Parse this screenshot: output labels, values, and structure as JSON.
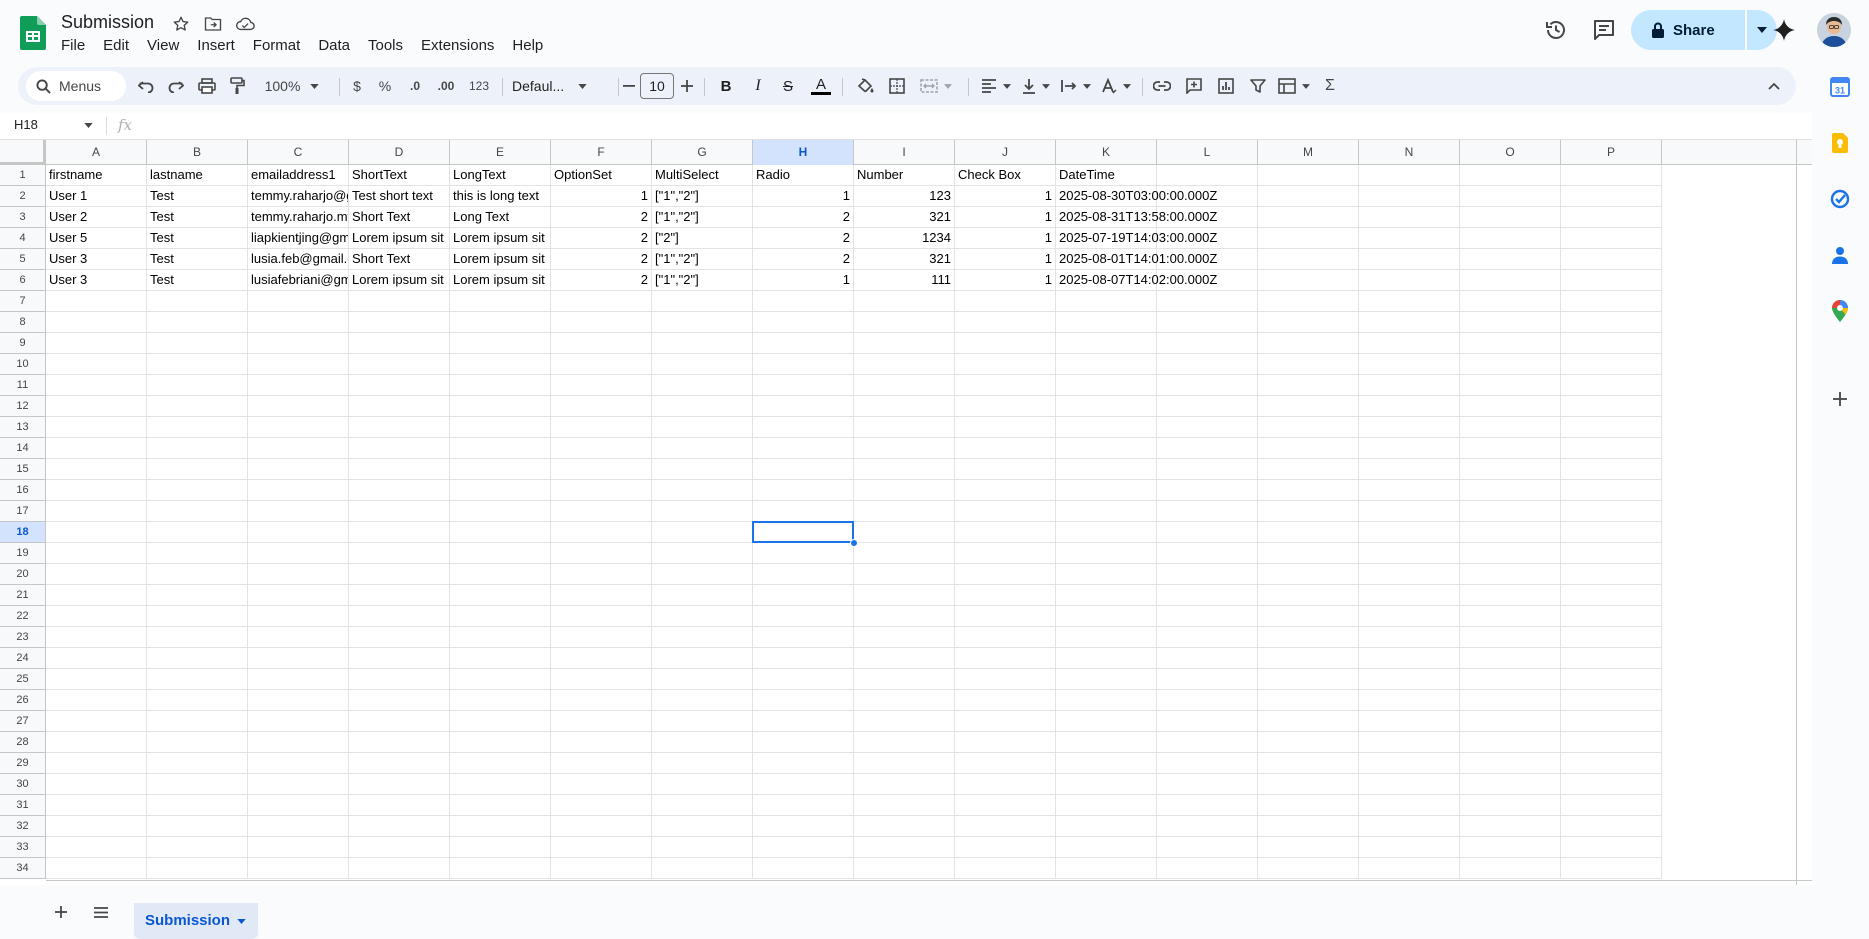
{
  "header": {
    "title": "Submission",
    "menus": [
      "File",
      "Edit",
      "View",
      "Insert",
      "Format",
      "Data",
      "Tools",
      "Extensions",
      "Help"
    ],
    "share_label": "Share"
  },
  "toolbar": {
    "search_label": "Menus",
    "zoom": "100%",
    "currency": "$",
    "percent": "%",
    "decrease_decimal": ".0",
    "increase_decimal": ".00",
    "number_format": "123",
    "font_family": "Defaul...",
    "font_size": "10"
  },
  "formula_bar": {
    "name_box": "H18",
    "fx_label": "fx"
  },
  "grid": {
    "columns": [
      "A",
      "B",
      "C",
      "D",
      "E",
      "F",
      "G",
      "H",
      "I",
      "J",
      "K",
      "L",
      "M",
      "N",
      "O",
      "P"
    ],
    "rows": [
      [
        "firstname",
        "lastname",
        "emailaddress1",
        "ShortText",
        "LongText",
        "OptionSet",
        "MultiSelect",
        "Radio",
        "Number",
        "Check Box",
        "DateTime"
      ],
      [
        "User 1",
        "Test",
        "temmy.raharjo@gmail.com",
        "Test short text",
        "this is long text",
        "1",
        "[\"1\",\"2\"]",
        "1",
        "123",
        "1",
        "2025-08-30T03:00:00.000Z"
      ],
      [
        "User 2",
        "Test",
        "temmy.raharjo.my@gmail.com",
        "Short Text",
        "Long Text",
        "2",
        "[\"1\",\"2\"]",
        "2",
        "321",
        "1",
        "2025-08-31T13:58:00.000Z"
      ],
      [
        "User 5",
        "Test",
        "liapkientjing@gmail.com",
        "Lorem ipsum sit",
        "Lorem ipsum sit",
        "2",
        "[\"2\"]",
        "2",
        "1234",
        "1",
        "2025-07-19T14:03:00.000Z"
      ],
      [
        "User 3",
        "Test",
        "lusia.feb@gmail.com",
        "Short Text",
        "Lorem ipsum sit",
        "2",
        "[\"1\",\"2\"]",
        "2",
        "321",
        "1",
        "2025-08-01T14:01:00.000Z"
      ],
      [
        "User 3",
        "Test",
        "lusiafebriani@gmail.com",
        "Lorem ipsum sit",
        "Lorem ipsum sit",
        "2",
        "[\"1\",\"2\"]",
        "1",
        "111",
        "1",
        "2025-08-07T14:02:00.000Z"
      ]
    ],
    "row_count": 34,
    "active_row": 18,
    "active_col": "H"
  },
  "sheets": {
    "tabs": [
      "Submission"
    ]
  },
  "colors": {
    "brand_green": "#0f9d58",
    "accent_blue": "#0b57d0",
    "share_bg": "#c2e7ff",
    "toolbar_bg": "#edf2fa",
    "selection": "#1a73e8"
  }
}
